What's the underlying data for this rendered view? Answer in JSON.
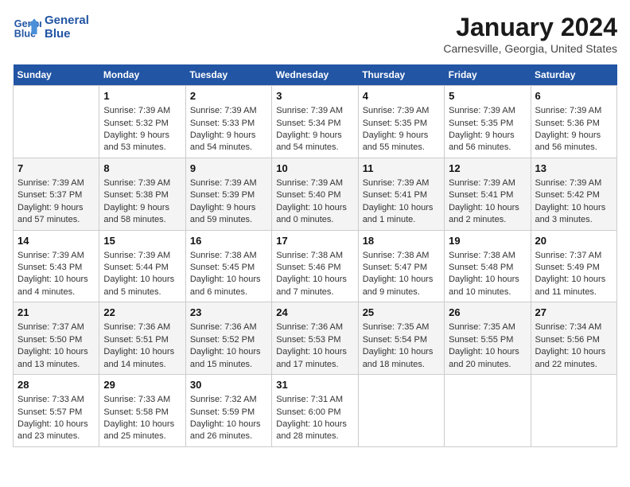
{
  "header": {
    "logo_line1": "General",
    "logo_line2": "Blue",
    "month": "January 2024",
    "location": "Carnesville, Georgia, United States"
  },
  "days_of_week": [
    "Sunday",
    "Monday",
    "Tuesday",
    "Wednesday",
    "Thursday",
    "Friday",
    "Saturday"
  ],
  "weeks": [
    [
      {
        "day": "",
        "sunrise": "",
        "sunset": "",
        "daylight": ""
      },
      {
        "day": "1",
        "sunrise": "7:39 AM",
        "sunset": "5:32 PM",
        "daylight": "9 hours and 53 minutes."
      },
      {
        "day": "2",
        "sunrise": "7:39 AM",
        "sunset": "5:33 PM",
        "daylight": "9 hours and 54 minutes."
      },
      {
        "day": "3",
        "sunrise": "7:39 AM",
        "sunset": "5:34 PM",
        "daylight": "9 hours and 54 minutes."
      },
      {
        "day": "4",
        "sunrise": "7:39 AM",
        "sunset": "5:35 PM",
        "daylight": "9 hours and 55 minutes."
      },
      {
        "day": "5",
        "sunrise": "7:39 AM",
        "sunset": "5:35 PM",
        "daylight": "9 hours and 56 minutes."
      },
      {
        "day": "6",
        "sunrise": "7:39 AM",
        "sunset": "5:36 PM",
        "daylight": "9 hours and 56 minutes."
      }
    ],
    [
      {
        "day": "7",
        "sunrise": "7:39 AM",
        "sunset": "5:37 PM",
        "daylight": "9 hours and 57 minutes."
      },
      {
        "day": "8",
        "sunrise": "7:39 AM",
        "sunset": "5:38 PM",
        "daylight": "9 hours and 58 minutes."
      },
      {
        "day": "9",
        "sunrise": "7:39 AM",
        "sunset": "5:39 PM",
        "daylight": "9 hours and 59 minutes."
      },
      {
        "day": "10",
        "sunrise": "7:39 AM",
        "sunset": "5:40 PM",
        "daylight": "10 hours and 0 minutes."
      },
      {
        "day": "11",
        "sunrise": "7:39 AM",
        "sunset": "5:41 PM",
        "daylight": "10 hours and 1 minute."
      },
      {
        "day": "12",
        "sunrise": "7:39 AM",
        "sunset": "5:41 PM",
        "daylight": "10 hours and 2 minutes."
      },
      {
        "day": "13",
        "sunrise": "7:39 AM",
        "sunset": "5:42 PM",
        "daylight": "10 hours and 3 minutes."
      }
    ],
    [
      {
        "day": "14",
        "sunrise": "7:39 AM",
        "sunset": "5:43 PM",
        "daylight": "10 hours and 4 minutes."
      },
      {
        "day": "15",
        "sunrise": "7:39 AM",
        "sunset": "5:44 PM",
        "daylight": "10 hours and 5 minutes."
      },
      {
        "day": "16",
        "sunrise": "7:38 AM",
        "sunset": "5:45 PM",
        "daylight": "10 hours and 6 minutes."
      },
      {
        "day": "17",
        "sunrise": "7:38 AM",
        "sunset": "5:46 PM",
        "daylight": "10 hours and 7 minutes."
      },
      {
        "day": "18",
        "sunrise": "7:38 AM",
        "sunset": "5:47 PM",
        "daylight": "10 hours and 9 minutes."
      },
      {
        "day": "19",
        "sunrise": "7:38 AM",
        "sunset": "5:48 PM",
        "daylight": "10 hours and 10 minutes."
      },
      {
        "day": "20",
        "sunrise": "7:37 AM",
        "sunset": "5:49 PM",
        "daylight": "10 hours and 11 minutes."
      }
    ],
    [
      {
        "day": "21",
        "sunrise": "7:37 AM",
        "sunset": "5:50 PM",
        "daylight": "10 hours and 13 minutes."
      },
      {
        "day": "22",
        "sunrise": "7:36 AM",
        "sunset": "5:51 PM",
        "daylight": "10 hours and 14 minutes."
      },
      {
        "day": "23",
        "sunrise": "7:36 AM",
        "sunset": "5:52 PM",
        "daylight": "10 hours and 15 minutes."
      },
      {
        "day": "24",
        "sunrise": "7:36 AM",
        "sunset": "5:53 PM",
        "daylight": "10 hours and 17 minutes."
      },
      {
        "day": "25",
        "sunrise": "7:35 AM",
        "sunset": "5:54 PM",
        "daylight": "10 hours and 18 minutes."
      },
      {
        "day": "26",
        "sunrise": "7:35 AM",
        "sunset": "5:55 PM",
        "daylight": "10 hours and 20 minutes."
      },
      {
        "day": "27",
        "sunrise": "7:34 AM",
        "sunset": "5:56 PM",
        "daylight": "10 hours and 22 minutes."
      }
    ],
    [
      {
        "day": "28",
        "sunrise": "7:33 AM",
        "sunset": "5:57 PM",
        "daylight": "10 hours and 23 minutes."
      },
      {
        "day": "29",
        "sunrise": "7:33 AM",
        "sunset": "5:58 PM",
        "daylight": "10 hours and 25 minutes."
      },
      {
        "day": "30",
        "sunrise": "7:32 AM",
        "sunset": "5:59 PM",
        "daylight": "10 hours and 26 minutes."
      },
      {
        "day": "31",
        "sunrise": "7:31 AM",
        "sunset": "6:00 PM",
        "daylight": "10 hours and 28 minutes."
      },
      {
        "day": "",
        "sunrise": "",
        "sunset": "",
        "daylight": ""
      },
      {
        "day": "",
        "sunrise": "",
        "sunset": "",
        "daylight": ""
      },
      {
        "day": "",
        "sunrise": "",
        "sunset": "",
        "daylight": ""
      }
    ]
  ],
  "labels": {
    "sunrise": "Sunrise:",
    "sunset": "Sunset:",
    "daylight": "Daylight:"
  }
}
